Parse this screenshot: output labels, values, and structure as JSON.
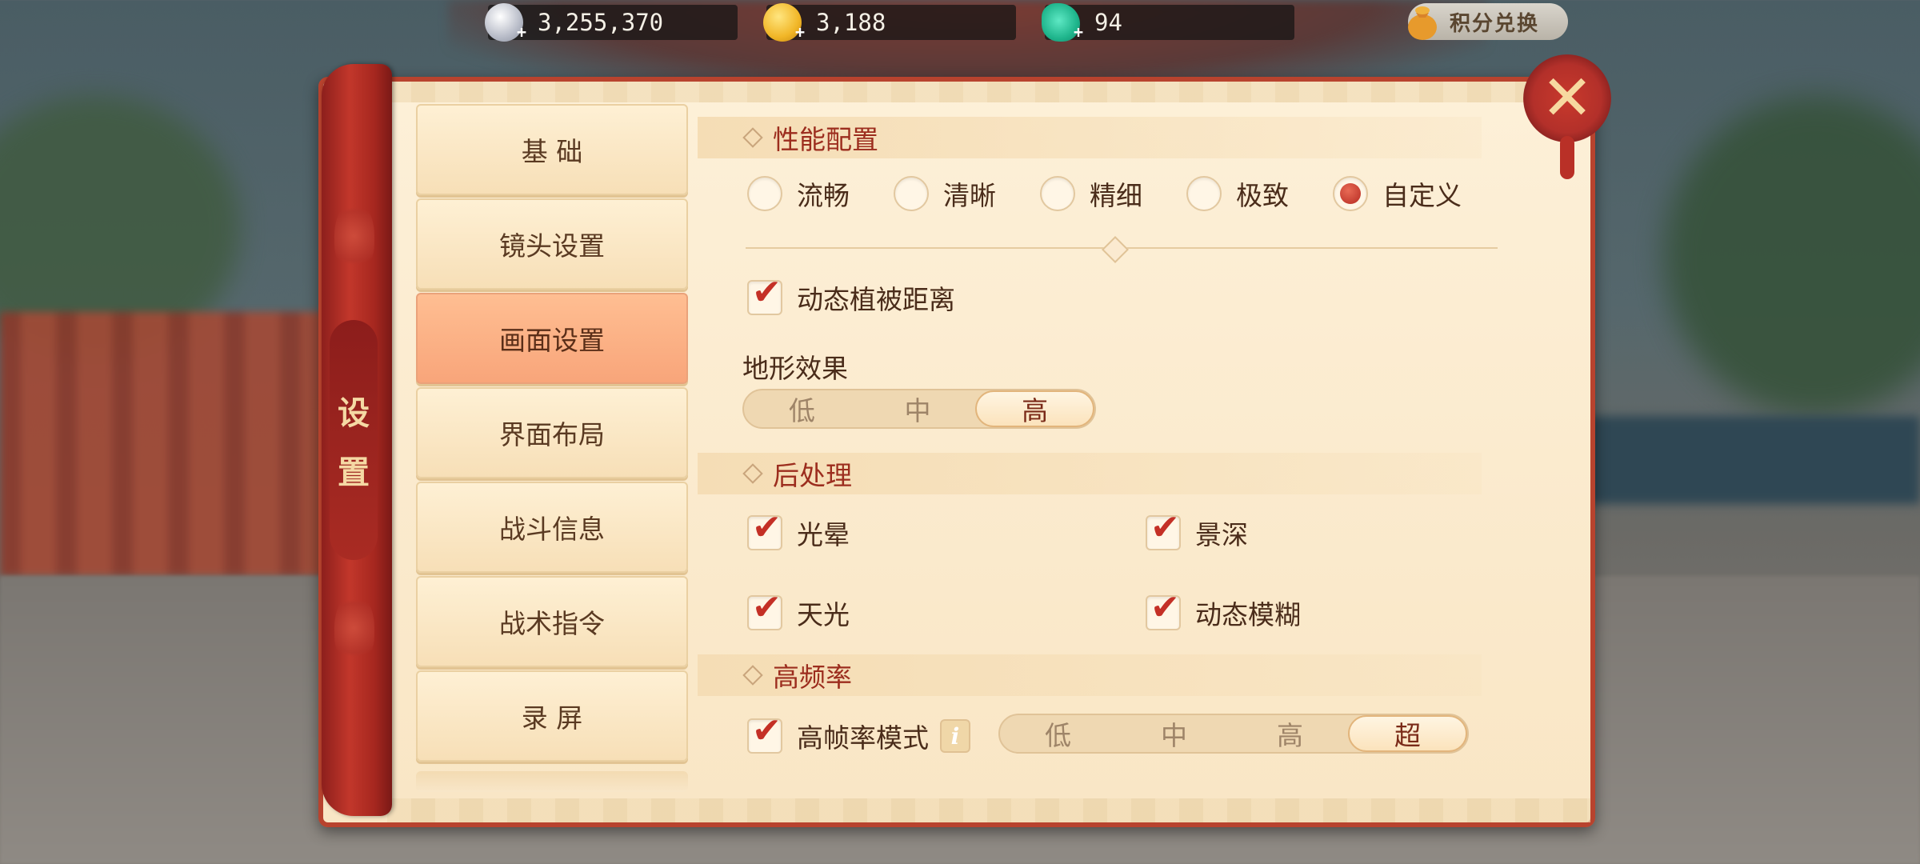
{
  "currency": [
    {
      "icon": "silver-coin-icon",
      "value": "3,255,370",
      "plus": "+"
    },
    {
      "icon": "gold-coin-icon",
      "value": "3,188",
      "plus": "+"
    },
    {
      "icon": "jade-gem-icon",
      "value": "94",
      "plus": "+"
    }
  ],
  "exchange_label": "积分兑换",
  "panel_title": [
    "设",
    "置"
  ],
  "sidebar": {
    "items": [
      {
        "label": "基 础"
      },
      {
        "label": "镜头设置"
      },
      {
        "label": "画面设置",
        "active": true
      },
      {
        "label": "界面布局"
      },
      {
        "label": "战斗信息"
      },
      {
        "label": "战术指令"
      },
      {
        "label": "录 屏"
      }
    ]
  },
  "performance": {
    "title": "性能配置",
    "options": [
      "流畅",
      "清晰",
      "精细",
      "极致",
      "自定义"
    ],
    "selected": "自定义"
  },
  "vegetation": {
    "label": "动态植被距离",
    "checked": true
  },
  "terrain": {
    "label": "地形效果",
    "options": [
      "低",
      "中",
      "高"
    ],
    "selected": "高"
  },
  "post": {
    "title": "后处理",
    "items": [
      {
        "label": "光晕",
        "checked": true
      },
      {
        "label": "景深",
        "checked": true
      },
      {
        "label": "天光",
        "checked": true
      },
      {
        "label": "动态模糊",
        "checked": true
      }
    ]
  },
  "hfr": {
    "title": "高频率",
    "mode_label": "高帧率模式",
    "checked": true,
    "info_glyph": "i",
    "options": [
      "低",
      "中",
      "高",
      "超"
    ],
    "selected": "超"
  },
  "check_glyph": "✔",
  "close_glyph": "✕",
  "colors": {
    "accent": "#b8432e",
    "panel": "#fdf0d8",
    "active_tab": "#f8a57a",
    "title_text": "#9c2d1e"
  }
}
